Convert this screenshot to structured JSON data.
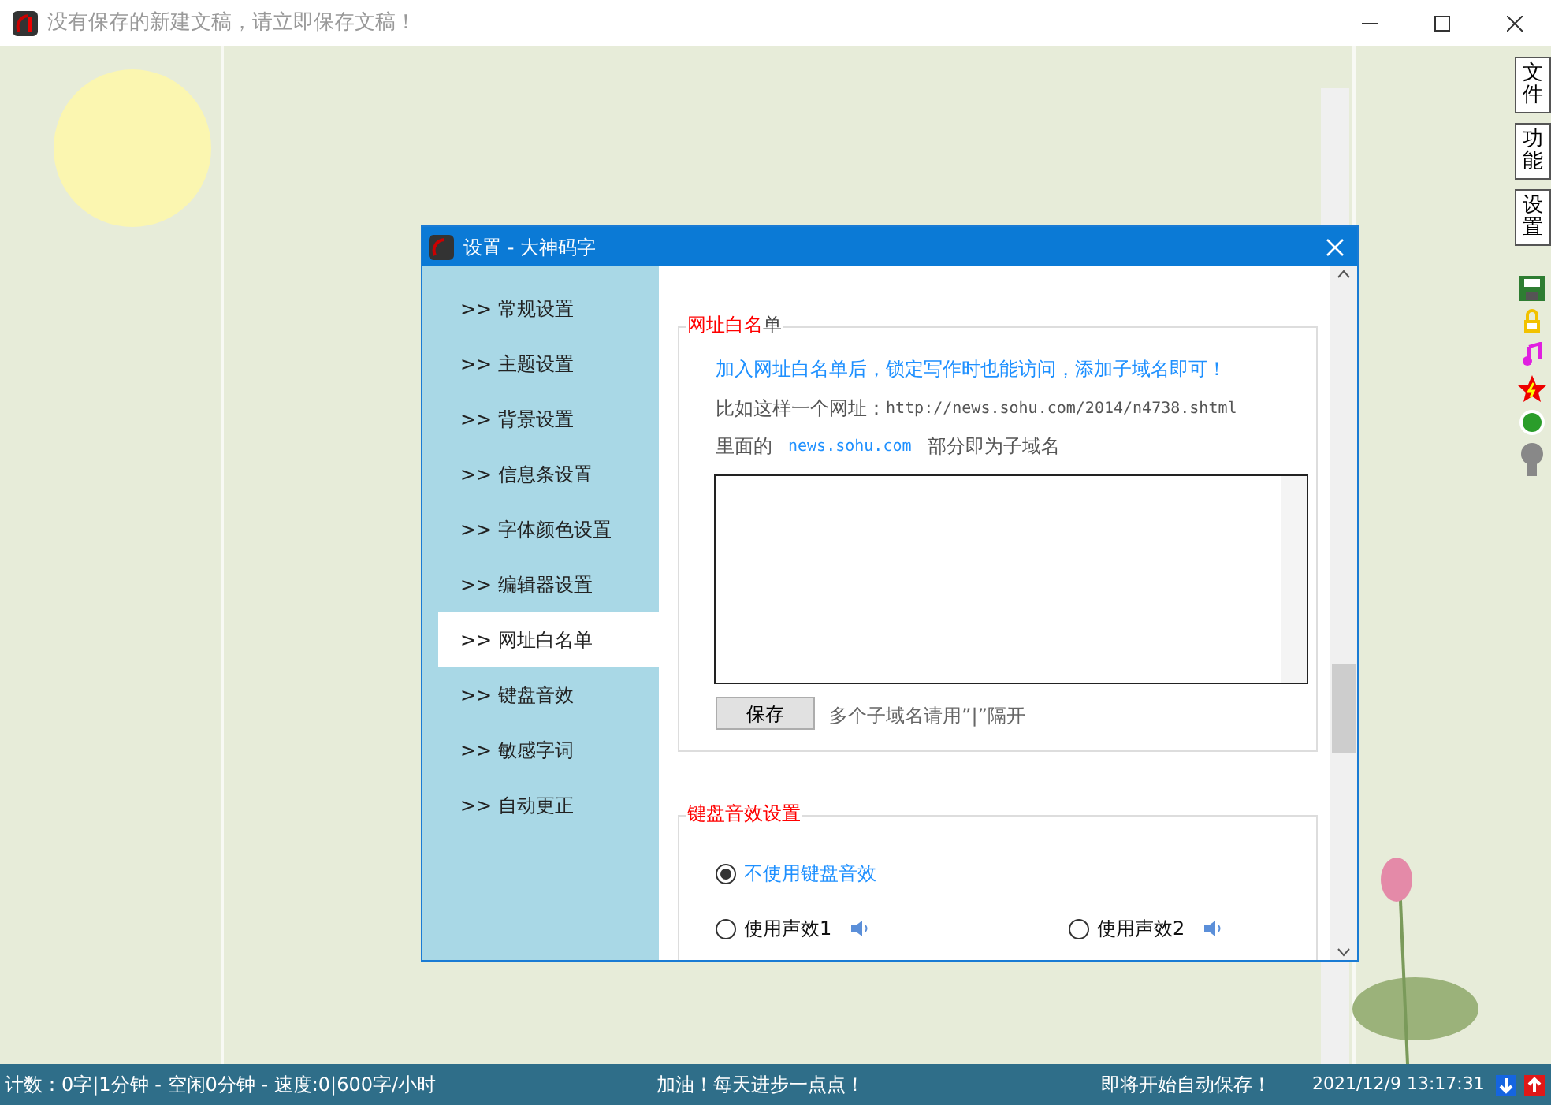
{
  "window": {
    "title": "没有保存的新建文稿，请立即保存文稿！"
  },
  "side_buttons": [
    "文件",
    "功能",
    "设置"
  ],
  "dialog": {
    "title": "设置 - 大神码字",
    "nav": [
      {
        "label": ">> 常规设置",
        "selected": false
      },
      {
        "label": ">> 主题设置",
        "selected": false
      },
      {
        "label": ">> 背景设置",
        "selected": false
      },
      {
        "label": ">> 信息条设置",
        "selected": false
      },
      {
        "label": ">> 字体颜色设置",
        "selected": false
      },
      {
        "label": ">> 编辑器设置",
        "selected": false
      },
      {
        "label": ">> 网址白名单",
        "selected": true
      },
      {
        "label": ">> 键盘音效",
        "selected": false
      },
      {
        "label": ">> 敏感字词",
        "selected": false
      },
      {
        "label": ">> 自动更正",
        "selected": false
      }
    ],
    "whitelist": {
      "heading_red": "网址",
      "heading_rest": "白名",
      "heading_end": "单",
      "tip": "加入网址白名单后，锁定写作时也能访问，添加子域名即可！",
      "example_label": "比如这样一个网址：",
      "example_url": "http://news.sohu.com/2014/n4738.shtml",
      "inner_prefix": "里面的",
      "inner_domain": "news.sohu.com",
      "inner_suffix": "部分即为子域名",
      "save_button": "保存",
      "save_hint": "多个子域名请用”|”隔开"
    },
    "sound": {
      "heading": "键盘音效设置",
      "options": [
        {
          "label": "不使用键盘音效",
          "selected": true,
          "kind": "plain"
        },
        {
          "label": "使用声效1",
          "selected": false,
          "kind": "sound"
        },
        {
          "label": "使用声效2",
          "selected": false,
          "kind": "sound"
        }
      ]
    }
  },
  "status_bar": {
    "stats": "计数：0字|1分钟 - 空闲0分钟 - 速度:0|600字/小时",
    "motto": "加油！每天进步一点点！",
    "autosave": "即将开始自动保存！",
    "datetime": "2021/12/9  13:17:31"
  }
}
